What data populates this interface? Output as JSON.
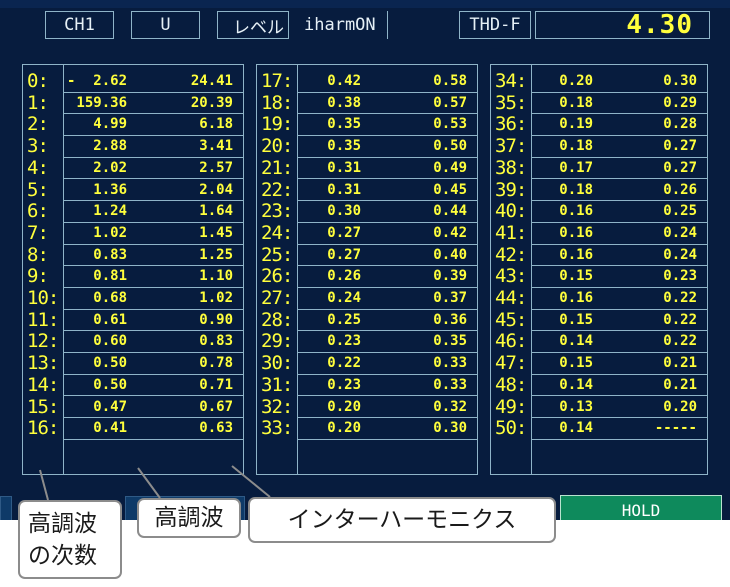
{
  "header": {
    "channel": "CH1",
    "parameter": "U",
    "level": "レベル",
    "mode": "iharmON",
    "thd_label": "THD-F",
    "thd_value": "4.30"
  },
  "harmonics": [
    {
      "order": "0:",
      "sign": "-",
      "v1": "2.62",
      "v2": "24.41"
    },
    {
      "order": "1:",
      "sign": "",
      "v1": "159.36",
      "v2": "20.39"
    },
    {
      "order": "2:",
      "sign": "",
      "v1": "4.99",
      "v2": "6.18"
    },
    {
      "order": "3:",
      "sign": "",
      "v1": "2.88",
      "v2": "3.41"
    },
    {
      "order": "4:",
      "sign": "",
      "v1": "2.02",
      "v2": "2.57"
    },
    {
      "order": "5:",
      "sign": "",
      "v1": "1.36",
      "v2": "2.04"
    },
    {
      "order": "6:",
      "sign": "",
      "v1": "1.24",
      "v2": "1.64"
    },
    {
      "order": "7:",
      "sign": "",
      "v1": "1.02",
      "v2": "1.45"
    },
    {
      "order": "8:",
      "sign": "",
      "v1": "0.83",
      "v2": "1.25"
    },
    {
      "order": "9:",
      "sign": "",
      "v1": "0.81",
      "v2": "1.10"
    },
    {
      "order": "10:",
      "sign": "",
      "v1": "0.68",
      "v2": "1.02"
    },
    {
      "order": "11:",
      "sign": "",
      "v1": "0.61",
      "v2": "0.90"
    },
    {
      "order": "12:",
      "sign": "",
      "v1": "0.60",
      "v2": "0.83"
    },
    {
      "order": "13:",
      "sign": "",
      "v1": "0.50",
      "v2": "0.78"
    },
    {
      "order": "14:",
      "sign": "",
      "v1": "0.50",
      "v2": "0.71"
    },
    {
      "order": "15:",
      "sign": "",
      "v1": "0.47",
      "v2": "0.67"
    },
    {
      "order": "16:",
      "sign": "",
      "v1": "0.41",
      "v2": "0.63"
    },
    {
      "order": "17:",
      "sign": "",
      "v1": "0.42",
      "v2": "0.58"
    },
    {
      "order": "18:",
      "sign": "",
      "v1": "0.38",
      "v2": "0.57"
    },
    {
      "order": "19:",
      "sign": "",
      "v1": "0.35",
      "v2": "0.53"
    },
    {
      "order": "20:",
      "sign": "",
      "v1": "0.35",
      "v2": "0.50"
    },
    {
      "order": "21:",
      "sign": "",
      "v1": "0.31",
      "v2": "0.49"
    },
    {
      "order": "22:",
      "sign": "",
      "v1": "0.31",
      "v2": "0.45"
    },
    {
      "order": "23:",
      "sign": "",
      "v1": "0.30",
      "v2": "0.44"
    },
    {
      "order": "24:",
      "sign": "",
      "v1": "0.27",
      "v2": "0.42"
    },
    {
      "order": "25:",
      "sign": "",
      "v1": "0.27",
      "v2": "0.40"
    },
    {
      "order": "26:",
      "sign": "",
      "v1": "0.26",
      "v2": "0.39"
    },
    {
      "order": "27:",
      "sign": "",
      "v1": "0.24",
      "v2": "0.37"
    },
    {
      "order": "28:",
      "sign": "",
      "v1": "0.25",
      "v2": "0.36"
    },
    {
      "order": "29:",
      "sign": "",
      "v1": "0.23",
      "v2": "0.35"
    },
    {
      "order": "30:",
      "sign": "",
      "v1": "0.22",
      "v2": "0.33"
    },
    {
      "order": "31:",
      "sign": "",
      "v1": "0.23",
      "v2": "0.33"
    },
    {
      "order": "32:",
      "sign": "",
      "v1": "0.20",
      "v2": "0.32"
    },
    {
      "order": "33:",
      "sign": "",
      "v1": "0.20",
      "v2": "0.30"
    },
    {
      "order": "34:",
      "sign": "",
      "v1": "0.20",
      "v2": "0.30"
    },
    {
      "order": "35:",
      "sign": "",
      "v1": "0.18",
      "v2": "0.29"
    },
    {
      "order": "36:",
      "sign": "",
      "v1": "0.19",
      "v2": "0.28"
    },
    {
      "order": "37:",
      "sign": "",
      "v1": "0.18",
      "v2": "0.27"
    },
    {
      "order": "38:",
      "sign": "",
      "v1": "0.17",
      "v2": "0.27"
    },
    {
      "order": "39:",
      "sign": "",
      "v1": "0.18",
      "v2": "0.26"
    },
    {
      "order": "40:",
      "sign": "",
      "v1": "0.16",
      "v2": "0.25"
    },
    {
      "order": "41:",
      "sign": "",
      "v1": "0.16",
      "v2": "0.24"
    },
    {
      "order": "42:",
      "sign": "",
      "v1": "0.16",
      "v2": "0.24"
    },
    {
      "order": "43:",
      "sign": "",
      "v1": "0.15",
      "v2": "0.23"
    },
    {
      "order": "44:",
      "sign": "",
      "v1": "0.16",
      "v2": "0.22"
    },
    {
      "order": "45:",
      "sign": "",
      "v1": "0.15",
      "v2": "0.22"
    },
    {
      "order": "46:",
      "sign": "",
      "v1": "0.14",
      "v2": "0.22"
    },
    {
      "order": "47:",
      "sign": "",
      "v1": "0.15",
      "v2": "0.21"
    },
    {
      "order": "48:",
      "sign": "",
      "v1": "0.14",
      "v2": "0.21"
    },
    {
      "order": "49:",
      "sign": "",
      "v1": "0.13",
      "v2": "0.20"
    },
    {
      "order": "50:",
      "sign": "",
      "v1": "0.14",
      "v2": "-----"
    }
  ],
  "footer": {
    "hold_label": "HOLD"
  },
  "callouts": {
    "order": "高調波\nの次数",
    "harmonic": "高調波",
    "interharmonic": "インターハーモニクス"
  },
  "colors": {
    "screen_bg": "#071c3e",
    "value_text": "#ffff3c",
    "grid_line": "#8fb4c8",
    "hold_bg": "#0e8a5c"
  }
}
